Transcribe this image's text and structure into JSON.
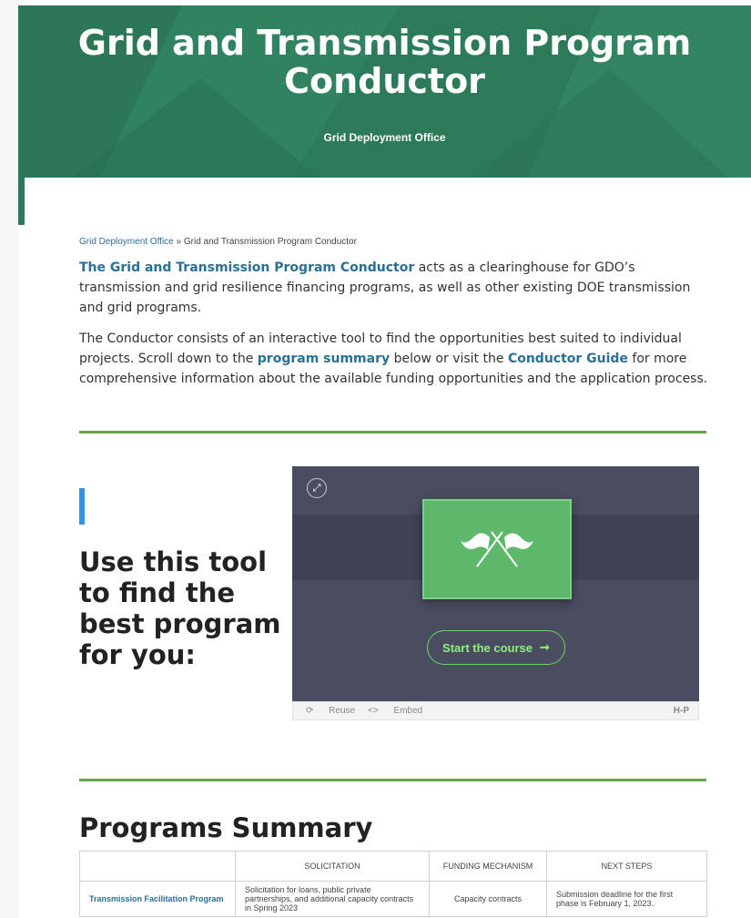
{
  "hero": {
    "title": "Grid and Transmission Program Conductor",
    "subtitle": "Grid Deployment Office",
    "bg_color": "#2f7e5d"
  },
  "breadcrumb": {
    "parent": "Grid Deployment Office",
    "separator": "»",
    "current": "Grid and Transmission Program Conductor"
  },
  "intro": {
    "p1_link": "The Grid and Transmission Program Conductor",
    "p1_rest": " acts as a clearinghouse for GDO’s transmission and grid resilience financing programs, as well as other existing DOE transmission and grid programs.",
    "p2_start": "The Conductor consists of an interactive tool to find the opportunities best suited to individual projects. Scroll down to the ",
    "p2_link1": "program summary",
    "p2_mid": " below or visit the ",
    "p2_link2": "Conductor Guide",
    "p2_end": " for more comprehensive information about the available funding opportunities and the application process."
  },
  "tool": {
    "heading": "Use this tool to find the best program for you:",
    "start_label": "Start the course",
    "arrow": "➞",
    "expand_icon": "⤢",
    "reuse_label": "Reuse",
    "embed_label": "Embed",
    "brand": "H-P",
    "accent": "#3d8ee8",
    "start_color": "#8ff07f"
  },
  "programs": {
    "title": "Programs Summary",
    "columns": [
      "",
      "SOLICITATION",
      "FUNDING MECHANISM",
      "NEXT STEPS"
    ],
    "rows": [
      {
        "name": "Transmission Facilitation Program",
        "solicitation": "Solicitation for loans, public private partnerships, and additional capacity contracts in Spring 2023",
        "mechanism": "Capacity contracts",
        "next_steps": "Submission deadline for the first phase is February 1, 2023."
      }
    ]
  },
  "colors": {
    "link": "#2b6f93",
    "rule": "#6ba442"
  }
}
